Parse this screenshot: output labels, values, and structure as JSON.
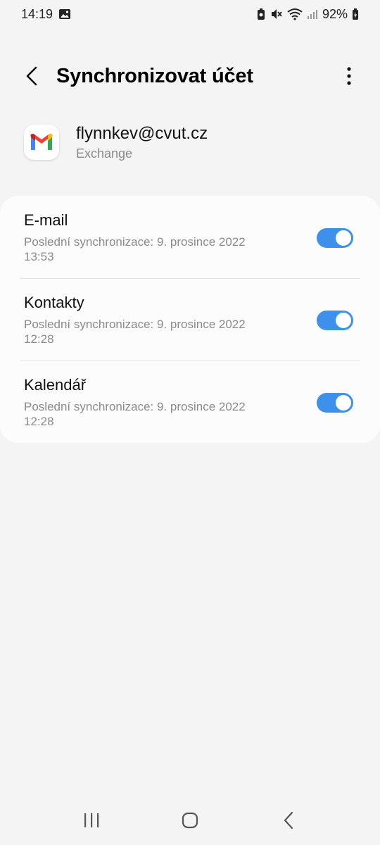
{
  "status_bar": {
    "time": "14:19",
    "battery": "92%"
  },
  "header": {
    "title": "Synchronizovat účet"
  },
  "account": {
    "email": "flynnkev@cvut.cz",
    "type": "Exchange",
    "logo_icon": "gmail-icon"
  },
  "sync_items": [
    {
      "title": "E-mail",
      "subtitle": "Poslední synchronizace: 9. prosince 2022 13:53",
      "enabled": true
    },
    {
      "title": "Kontakty",
      "subtitle": "Poslední synchronizace: 9. prosince 2022 12:28",
      "enabled": true
    },
    {
      "title": "Kalendář",
      "subtitle": "Poslední synchronizace: 9. prosince 2022 12:28",
      "enabled": true
    }
  ],
  "colors": {
    "accent": "#3e91ea",
    "background": "#f4f4f4",
    "card": "#fcfcfc"
  }
}
